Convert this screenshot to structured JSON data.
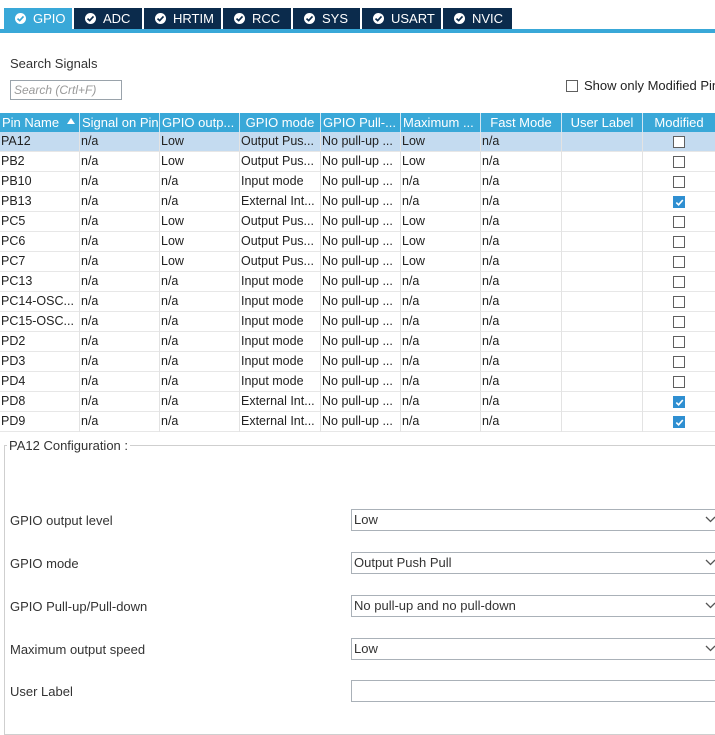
{
  "tabs": [
    {
      "label": "GPIO",
      "active": true
    },
    {
      "label": "ADC",
      "active": false
    },
    {
      "label": "HRTIM",
      "active": false
    },
    {
      "label": "RCC",
      "active": false
    },
    {
      "label": "SYS",
      "active": false
    },
    {
      "label": "USART",
      "active": false
    },
    {
      "label": "NVIC",
      "active": false
    }
  ],
  "search": {
    "title": "Search Signals",
    "placeholder": "Search (Crtl+F)",
    "show_modified_label": "Show only Modified Pins",
    "show_modified_checked": false
  },
  "table": {
    "columns": [
      "Pin Name",
      "Signal on Pin",
      "GPIO outp...",
      "GPIO mode",
      "GPIO Pull-...",
      "Maximum ...",
      "Fast Mode",
      "User Label",
      "Modified"
    ],
    "rows": [
      {
        "pin": "PA12",
        "signal": "n/a",
        "output": "Low",
        "mode": "Output Pus...",
        "pull": "No pull-up ...",
        "speed": "Low",
        "fast": "n/a",
        "label": "",
        "modified": false,
        "selected": true
      },
      {
        "pin": "PB2",
        "signal": "n/a",
        "output": "Low",
        "mode": "Output Pus...",
        "pull": "No pull-up ...",
        "speed": "Low",
        "fast": "n/a",
        "label": "",
        "modified": false,
        "selected": false
      },
      {
        "pin": "PB10",
        "signal": "n/a",
        "output": "n/a",
        "mode": "Input mode",
        "pull": "No pull-up ...",
        "speed": "n/a",
        "fast": "n/a",
        "label": "",
        "modified": false,
        "selected": false
      },
      {
        "pin": "PB13",
        "signal": "n/a",
        "output": "n/a",
        "mode": "External Int...",
        "pull": "No pull-up ...",
        "speed": "n/a",
        "fast": "n/a",
        "label": "",
        "modified": true,
        "selected": false
      },
      {
        "pin": "PC5",
        "signal": "n/a",
        "output": "Low",
        "mode": "Output Pus...",
        "pull": "No pull-up ...",
        "speed": "Low",
        "fast": "n/a",
        "label": "",
        "modified": false,
        "selected": false
      },
      {
        "pin": "PC6",
        "signal": "n/a",
        "output": "Low",
        "mode": "Output Pus...",
        "pull": "No pull-up ...",
        "speed": "Low",
        "fast": "n/a",
        "label": "",
        "modified": false,
        "selected": false
      },
      {
        "pin": "PC7",
        "signal": "n/a",
        "output": "Low",
        "mode": "Output Pus...",
        "pull": "No pull-up ...",
        "speed": "Low",
        "fast": "n/a",
        "label": "",
        "modified": false,
        "selected": false
      },
      {
        "pin": "PC13",
        "signal": "n/a",
        "output": "n/a",
        "mode": "Input mode",
        "pull": "No pull-up ...",
        "speed": "n/a",
        "fast": "n/a",
        "label": "",
        "modified": false,
        "selected": false
      },
      {
        "pin": "PC14-OSC...",
        "signal": "n/a",
        "output": "n/a",
        "mode": "Input mode",
        "pull": "No pull-up ...",
        "speed": "n/a",
        "fast": "n/a",
        "label": "",
        "modified": false,
        "selected": false
      },
      {
        "pin": "PC15-OSC...",
        "signal": "n/a",
        "output": "n/a",
        "mode": "Input mode",
        "pull": "No pull-up ...",
        "speed": "n/a",
        "fast": "n/a",
        "label": "",
        "modified": false,
        "selected": false
      },
      {
        "pin": "PD2",
        "signal": "n/a",
        "output": "n/a",
        "mode": "Input mode",
        "pull": "No pull-up ...",
        "speed": "n/a",
        "fast": "n/a",
        "label": "",
        "modified": false,
        "selected": false
      },
      {
        "pin": "PD3",
        "signal": "n/a",
        "output": "n/a",
        "mode": "Input mode",
        "pull": "No pull-up ...",
        "speed": "n/a",
        "fast": "n/a",
        "label": "",
        "modified": false,
        "selected": false
      },
      {
        "pin": "PD4",
        "signal": "n/a",
        "output": "n/a",
        "mode": "Input mode",
        "pull": "No pull-up ...",
        "speed": "n/a",
        "fast": "n/a",
        "label": "",
        "modified": false,
        "selected": false
      },
      {
        "pin": "PD8",
        "signal": "n/a",
        "output": "n/a",
        "mode": "External Int...",
        "pull": "No pull-up ...",
        "speed": "n/a",
        "fast": "n/a",
        "label": "",
        "modified": true,
        "selected": false
      },
      {
        "pin": "PD9",
        "signal": "n/a",
        "output": "n/a",
        "mode": "External Int...",
        "pull": "No pull-up ...",
        "speed": "n/a",
        "fast": "n/a",
        "label": "",
        "modified": true,
        "selected": false
      }
    ]
  },
  "config": {
    "title": "PA12 Configuration :",
    "fields": [
      {
        "label": "GPIO output level",
        "value": "Low",
        "type": "select"
      },
      {
        "label": "GPIO mode",
        "value": "Output Push Pull",
        "type": "select"
      },
      {
        "label": "GPIO Pull-up/Pull-down",
        "value": "No pull-up and no pull-down",
        "type": "select"
      },
      {
        "label": "Maximum output speed",
        "value": "Low",
        "type": "select"
      },
      {
        "label": "User Label",
        "value": "",
        "type": "input"
      }
    ]
  },
  "colors": {
    "tab_dark": "#0b2b4c",
    "accent": "#39a8d8",
    "selected_row": "#c4dbf0",
    "checkbox_checked": "#2f8fd1"
  },
  "icons": {
    "tab_status": "check-circle-icon",
    "sort": "sort-ascending-icon",
    "dropdown": "chevron-down-icon",
    "modified_checked": "checkmark-icon"
  }
}
